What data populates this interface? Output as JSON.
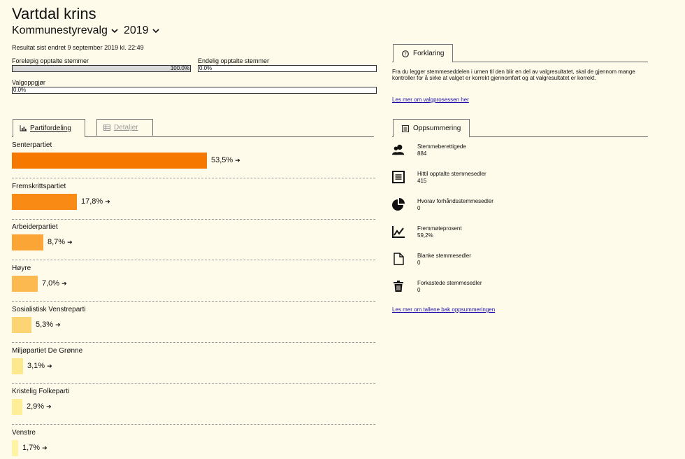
{
  "header": {
    "title": "Vartdal krins",
    "election": "Kommunestyrevalg",
    "year": "2019"
  },
  "status": {
    "last_changed": "Resultat sist endret 9 september 2019 kl. 22:49",
    "preliminary_label": "Foreløpig opptalte stemmer",
    "preliminary_value": "100.0%",
    "preliminary_fraction": 1.0,
    "final_label": "Endelig opptalte stemmer",
    "final_value": "0.0%",
    "settlement_label": "Valgoppgjør",
    "settlement_value": "0.0%"
  },
  "tabs": {
    "party_distribution": "Partifordeling",
    "details": "Detaljer"
  },
  "parties": [
    {
      "name": "Senterpartiet",
      "value": "53,5%",
      "pct": 53.5,
      "color": "#f77800"
    },
    {
      "name": "Fremskrittspartiet",
      "value": "17,8%",
      "pct": 17.8,
      "color": "#f98a14"
    },
    {
      "name": "Arbeiderpartiet",
      "value": "8,7%",
      "pct": 8.7,
      "color": "#fba537"
    },
    {
      "name": "Høyre",
      "value": "7,0%",
      "pct": 7.0,
      "color": "#fcb950"
    },
    {
      "name": "Sosialistisk Venstreparti",
      "value": "5,3%",
      "pct": 5.3,
      "color": "#fdd474"
    },
    {
      "name": "Miljøpartiet De Grønne",
      "value": "3,1%",
      "pct": 3.1,
      "color": "#fde88c"
    },
    {
      "name": "Kristelig Folkeparti",
      "value": "2,9%",
      "pct": 2.9,
      "color": "#feee98"
    },
    {
      "name": "Venstre",
      "value": "1,7%",
      "pct": 1.7,
      "color": "#fff3a6"
    }
  ],
  "explanation": {
    "tab": "Forklaring",
    "text": "Fra du legger stemmeseddelen i urnen til den blir en del av valgresultatet, skal de gjennom mange kontroller for å sirke at valget er korrekt gjennomført og at valgresultatet er korrekt.",
    "link": "Les mer om valgprosessen her"
  },
  "summary": {
    "tab": "Oppsummering",
    "items": [
      {
        "label": "Stemmeberettigede",
        "value": "884",
        "icon": "users-icon"
      },
      {
        "label": "Hittil opptalte stemmesedler",
        "value": "415",
        "icon": "list-icon"
      },
      {
        "label": "Hvorav forhåndsstemmesedler",
        "value": "0",
        "icon": "pie-icon"
      },
      {
        "label": "Fremmøteprosent",
        "value": "59,2%",
        "icon": "line-chart-icon"
      },
      {
        "label": "Blanke stemmesedler",
        "value": "0",
        "icon": "blank-doc-icon"
      },
      {
        "label": "Forkastede stemmesedler",
        "value": "0",
        "icon": "trash-icon"
      }
    ],
    "link": "Les mer om tallene bak oppsummeringen"
  }
}
